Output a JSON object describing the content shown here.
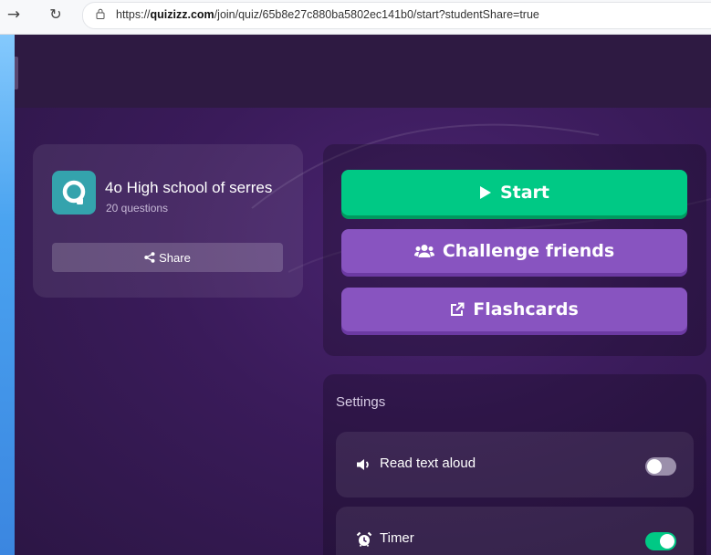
{
  "browser": {
    "url_prefix": "https://",
    "url_domain": "quizizz.com",
    "url_path": "/join/quiz/65b8e27c880ba5802ec141b0/start?studentShare=true"
  },
  "quiz": {
    "title": "4o High school of serres",
    "question_count": "20 questions",
    "share_label": "Share"
  },
  "actions": {
    "start_label": "Start",
    "challenge_label": "Challenge friends",
    "flashcards_label": "Flashcards"
  },
  "settings": {
    "title": "Settings",
    "items": [
      {
        "label": "Read text aloud",
        "icon": "speaker-icon",
        "enabled": false
      },
      {
        "label": "Timer",
        "icon": "alarm-clock-icon",
        "enabled": true
      }
    ]
  },
  "colors": {
    "start_green": "#00c985",
    "purple_button": "#8854c0",
    "logo_teal": "#34a3ad"
  }
}
